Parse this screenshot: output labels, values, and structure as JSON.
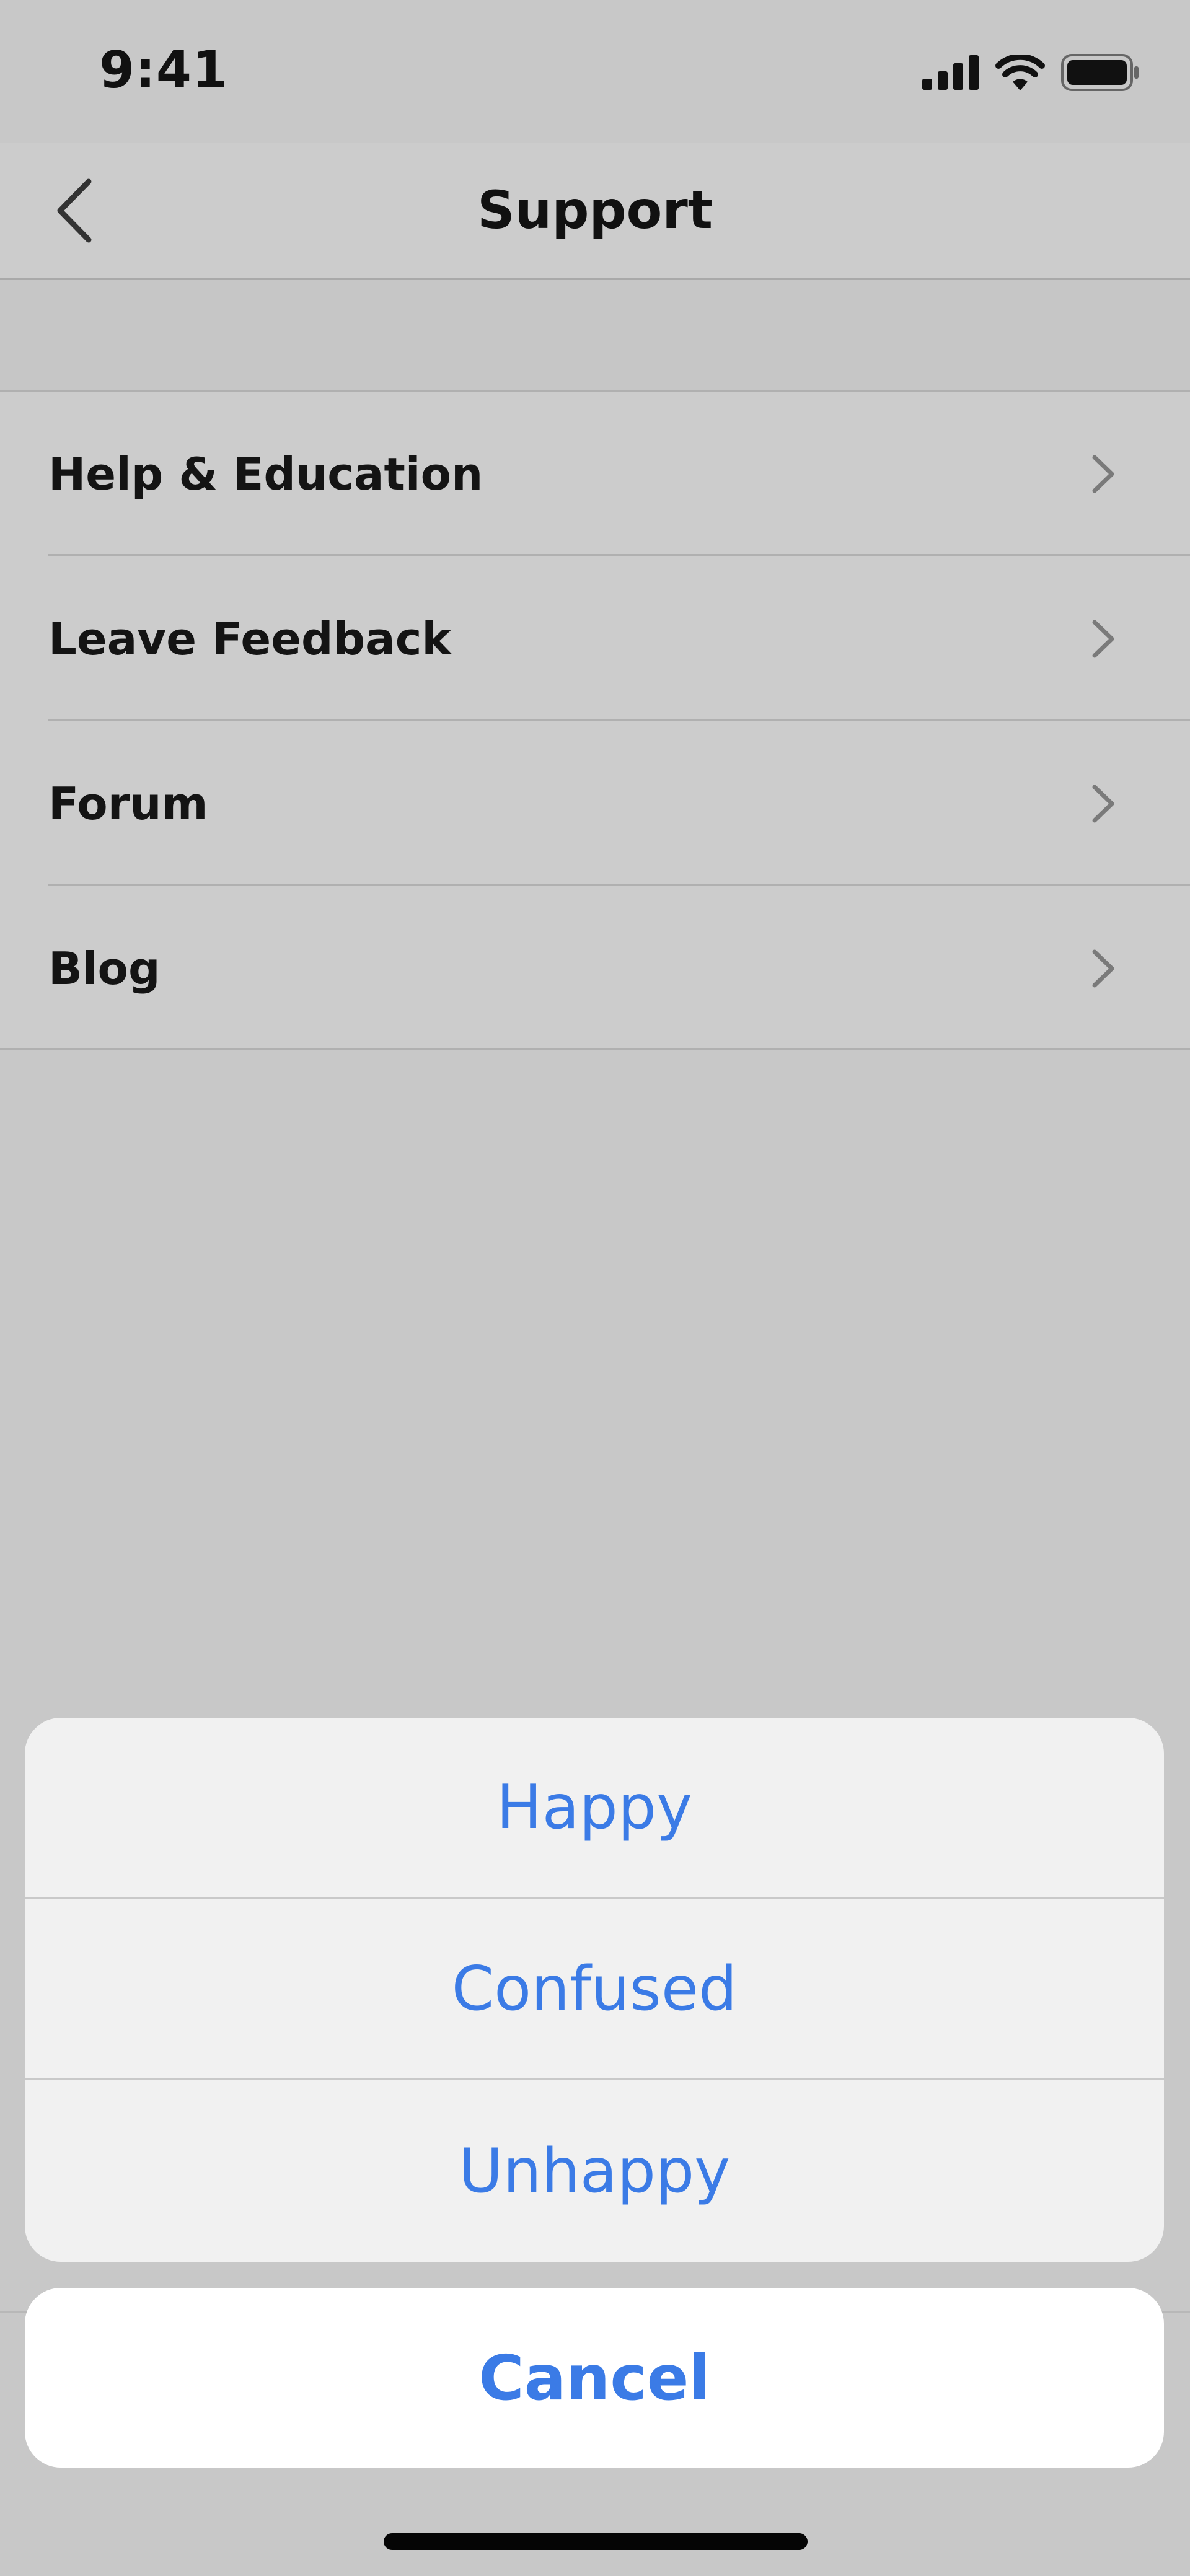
{
  "status_bar": {
    "time": "9:41",
    "icons": [
      "cellular-signal-icon",
      "wifi-icon",
      "battery-icon"
    ]
  },
  "nav": {
    "title": "Support",
    "back_icon": "chevron-left-icon"
  },
  "menu": {
    "items": [
      {
        "label": "Help & Education",
        "icon": "chevron-right-icon"
      },
      {
        "label": "Leave Feedback",
        "icon": "chevron-right-icon"
      },
      {
        "label": "Forum",
        "icon": "chevron-right-icon"
      },
      {
        "label": "Blog",
        "icon": "chevron-right-icon"
      }
    ]
  },
  "action_sheet": {
    "options": [
      {
        "label": "Happy"
      },
      {
        "label": "Confused"
      },
      {
        "label": "Unhappy"
      }
    ],
    "cancel_label": "Cancel"
  },
  "colors": {
    "accent": "#3b7be6",
    "background": "#c8c8c8",
    "sheet": "#f1f1f1",
    "text": "#141414"
  }
}
